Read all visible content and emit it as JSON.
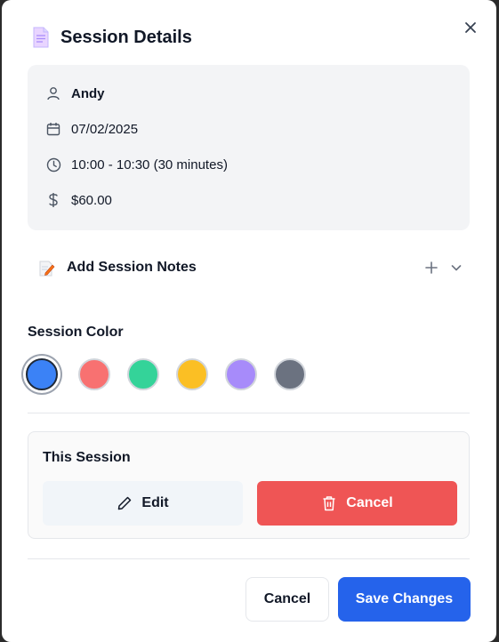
{
  "header": {
    "title": "Session Details",
    "doc_icon": "document-icon",
    "close_icon": "close-icon"
  },
  "session_info": {
    "client_name": "Andy",
    "date": "07/02/2025",
    "time": "10:00 - 10:30 (30 minutes)",
    "price": "$60.00"
  },
  "notes": {
    "label": "Add Session Notes"
  },
  "session_color": {
    "label": "Session Color",
    "swatches": [
      {
        "name": "blue",
        "hex": "#3b82f6",
        "selected": true
      },
      {
        "name": "red",
        "hex": "#f87171",
        "selected": false
      },
      {
        "name": "green",
        "hex": "#34d399",
        "selected": false
      },
      {
        "name": "yellow",
        "hex": "#fbbf24",
        "selected": false
      },
      {
        "name": "purple",
        "hex": "#a78bfa",
        "selected": false
      },
      {
        "name": "gray",
        "hex": "#6b7280",
        "selected": false
      }
    ]
  },
  "this_session": {
    "title": "This Session",
    "edit_label": "Edit",
    "cancel_label": "Cancel"
  },
  "footer": {
    "cancel_label": "Cancel",
    "save_label": "Save Changes"
  },
  "colors": {
    "primary": "#2563eb",
    "danger": "#ef5555",
    "card_bg": "#f3f4f6"
  }
}
